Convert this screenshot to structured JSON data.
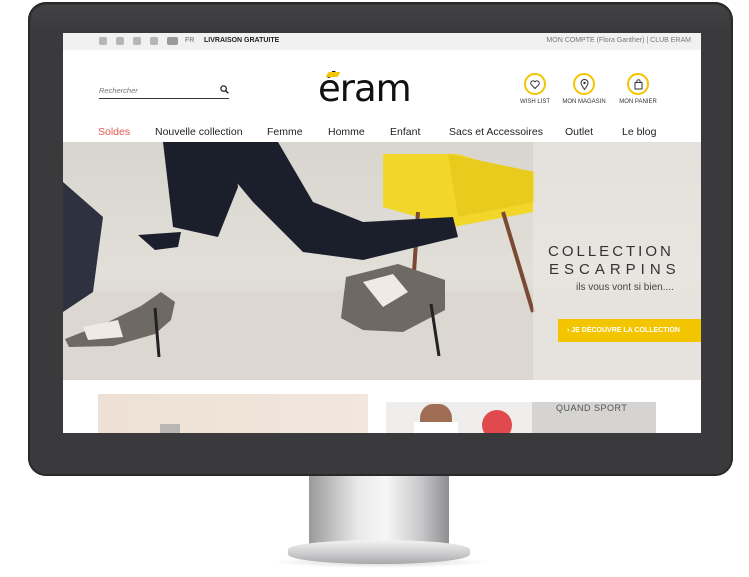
{
  "topbar": {
    "language": "FR",
    "free_shipping": "LIVRAISON GRATUITE",
    "account_text": "MON COMPTE (Flora Ganther)  |  CLUB ERAM",
    "social_icons": [
      "facebook-icon",
      "twitter-icon",
      "instagram-icon",
      "pinterest-icon",
      "youtube-icon"
    ]
  },
  "search": {
    "placeholder": "Rechercher"
  },
  "logo": {
    "text": "éram",
    "accent_color": "#f2c500"
  },
  "quick_links": [
    {
      "label": "WISH LIST",
      "icon": "heart-icon"
    },
    {
      "label": "MON MAGASIN",
      "icon": "location-pin-icon"
    },
    {
      "label": "MON PANIER",
      "icon": "shopping-bag-icon"
    }
  ],
  "nav": [
    "Soldes",
    "Nouvelle collection",
    "Femme",
    "Homme",
    "Enfant",
    "Sacs et Accessoires",
    "Outlet",
    "Le blog"
  ],
  "hero": {
    "line1": "COLLECTION",
    "line2": "ESCARPINS",
    "line3": "ils vous vont si bien....",
    "cta": "› JE DÉCOUVRE LA COLLECTION",
    "cta_color": "#f2c500"
  },
  "promo": {
    "text": "QUAND SPORT"
  },
  "colors": {
    "sale": "#e8564f",
    "accent": "#f2c500"
  }
}
